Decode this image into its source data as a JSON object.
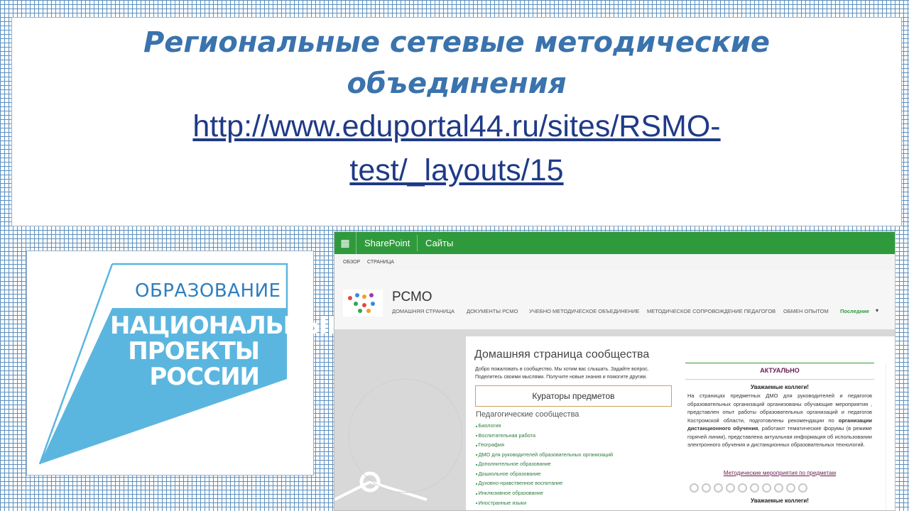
{
  "slide": {
    "title_line1": "Региональные сетевые методические",
    "title_line2": "объединения",
    "url_line1": "http://www.eduportal44.ru/sites/RSMO-",
    "url_line2": "test/_layouts/15"
  },
  "logo": {
    "top_text": "ОБРАЗОВАНИЕ",
    "main_line1": "НАЦИОНАЛЬНЫЕ",
    "main_line2": "ПРОЕКТЫ",
    "main_line3": "РОССИИ",
    "colors": {
      "blue": "#5bb6df",
      "text": "#2d7fbf"
    }
  },
  "screenshot": {
    "suite_bar": {
      "waffle_icon": "app-launcher-icon",
      "brand": "SharePoint",
      "sites": "Сайты",
      "color": "#2f9a3c"
    },
    "ribbon": {
      "tab1": "ОБЗОР",
      "tab2": "СТРАНИЦА"
    },
    "site": {
      "title": "РСМО",
      "nav": [
        "ДОМАШНЯЯ СТРАНИЦА",
        "ДОКУМЕНТЫ РСМО",
        "УЧЕБНО МЕТОДИЧЕСКОЕ ОБЪЕДИНЕНИЕ",
        "МЕТОДИЧЕСКОЕ СОПРОВОЖДЕНИЕ ПЕДАГОГОВ",
        "ОБМЕН ОПЫТОМ"
      ],
      "recent": "Последние",
      "recent_icon": "caret-down-icon"
    },
    "main": {
      "home_title": "Домашняя страница сообщества",
      "welcome_line1": "Добро пожаловать в сообщество. Мы хотим вас слышать. Задайте вопрос.",
      "welcome_line2": "Поделитесь своими мыслями. Получите новые знания и помогите другим.",
      "curators": "Кураторы предметов",
      "ped_title": "Педагогические сообщества",
      "ped_items": [
        "Биология",
        "Воспитательная работа",
        "География",
        "ДМО для руководителей образовательных организаций",
        "Дополнительное образование",
        "Дошкольное образование",
        "Духовно-нравственное воспитание",
        "Инклюзивное образование",
        "Иностранные языки"
      ]
    },
    "aktual": {
      "heading": "АКТУАЛЬНО",
      "subheading": "Уважаемые коллеги!",
      "text_part1": "На страницах предметных ДМО для руководителей и педагогов образовательных организаций организованы обучающие мероприятия , представлен опыт работы образовательных организаций и педагогов Костромской области, подготовлены рекомендации по ",
      "text_bold": "организации дистанционного обучения",
      "text_part2": ", работают тематические форумы (в режиме горячей линии), представлена актуальная информация об использовании электронного обучения и дистанционных образовательных технологий.",
      "link": "Методические мероприятия по предметам",
      "subheading2": "Уважаемые коллеги!",
      "carousel_count": 10
    }
  }
}
